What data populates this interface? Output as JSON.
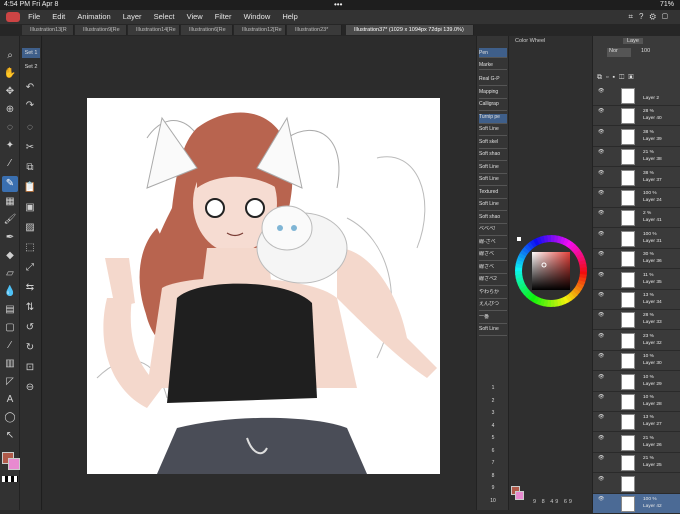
{
  "status_bar": {
    "time": "4:54 PM",
    "date": "Fri Apr 8",
    "dots": "•••",
    "battery": "71%"
  },
  "menu": [
    "File",
    "Edit",
    "Animation",
    "Layer",
    "Select",
    "View",
    "Filter",
    "Window",
    "Help"
  ],
  "tabs": [
    {
      "label": "Illustration13[R"
    },
    {
      "label": "Illustration9[Re"
    },
    {
      "label": "Illustration14[Re"
    },
    {
      "label": "Illustration6[Re"
    },
    {
      "label": "Illustration12[Re"
    },
    {
      "label": "Illustration23*"
    },
    {
      "label": "Illustration37* (1029 x 1094px 72dpi 139.0%)"
    }
  ],
  "set_buttons": [
    "Set 1",
    "Set 2"
  ],
  "tools": [
    "zoom-icon",
    "hand-icon",
    "move-icon",
    "transform-icon",
    "lasso-icon",
    "magic-wand-icon",
    "eyedropper-icon",
    "pen-icon",
    "pattern-icon",
    "brush-icon",
    "airbrush-icon",
    "fill-icon",
    "eraser-icon",
    "blend-icon",
    "gradient-icon",
    "shape-icon",
    "ruler-icon",
    "frame-icon",
    "text-icon",
    "balloon-icon",
    "operation-icon"
  ],
  "brush_panel": {
    "header": "Pen",
    "header2": "Marke",
    "items": [
      "Real G-P",
      "Mapping",
      "Calligrap",
      "Turnip pe",
      "Soft Line",
      "Soft skel",
      "Soft shao",
      "Soft Line",
      "Soft Line",
      "Textured",
      "Soft Line",
      "Soft shao",
      "ベベべ!",
      "線-ざべ",
      "線ざべ",
      "線ざべ",
      "線ざべ2",
      "やわらか",
      "えんぴつ",
      "一番",
      "Soft Line"
    ],
    "active_index": 3,
    "sizes": [
      "1",
      "2",
      "3",
      "4",
      "5",
      "6",
      "7",
      "8",
      "9",
      "10"
    ]
  },
  "color_panel": {
    "title": "Color Wheel",
    "bottom": [
      "9",
      "8",
      "49",
      "69"
    ]
  },
  "layer_panel": {
    "tab": "Laye",
    "blend": "Nor",
    "opacity": "100",
    "layers": [
      {
        "pct": "",
        "name": "Layer 2"
      },
      {
        "pct": "28 %",
        "name": "Layer 40"
      },
      {
        "pct": "38 %",
        "name": "Layer 39"
      },
      {
        "pct": "21 %",
        "name": "Layer 38"
      },
      {
        "pct": "38 %",
        "name": "Layer 37"
      },
      {
        "pct": "100 %",
        "name": "Layer 24"
      },
      {
        "pct": "2 %",
        "name": "Layer 41"
      },
      {
        "pct": "100 %",
        "name": "Layer 31"
      },
      {
        "pct": "30 %",
        "name": "Layer 36"
      },
      {
        "pct": "11 %",
        "name": "Layer 35"
      },
      {
        "pct": "13 %",
        "name": "Layer 34"
      },
      {
        "pct": "28 %",
        "name": "Layer 33"
      },
      {
        "pct": "23 %",
        "name": "Layer 32"
      },
      {
        "pct": "10 %",
        "name": "Layer 30"
      },
      {
        "pct": "10 %",
        "name": "Layer 29"
      },
      {
        "pct": "10 %",
        "name": "Layer 28"
      },
      {
        "pct": "13 %",
        "name": "Layer 27"
      },
      {
        "pct": "21 %",
        "name": "Layer 26"
      },
      {
        "pct": "21 %",
        "name": "Layer 25"
      },
      {
        "pct": "",
        "name": ""
      },
      {
        "pct": "100 %",
        "name": "Layer 42"
      }
    ]
  },
  "colors": {
    "accent": "#3a6fb0",
    "fg": "#b05a4a",
    "bg": "#e88ad0"
  }
}
